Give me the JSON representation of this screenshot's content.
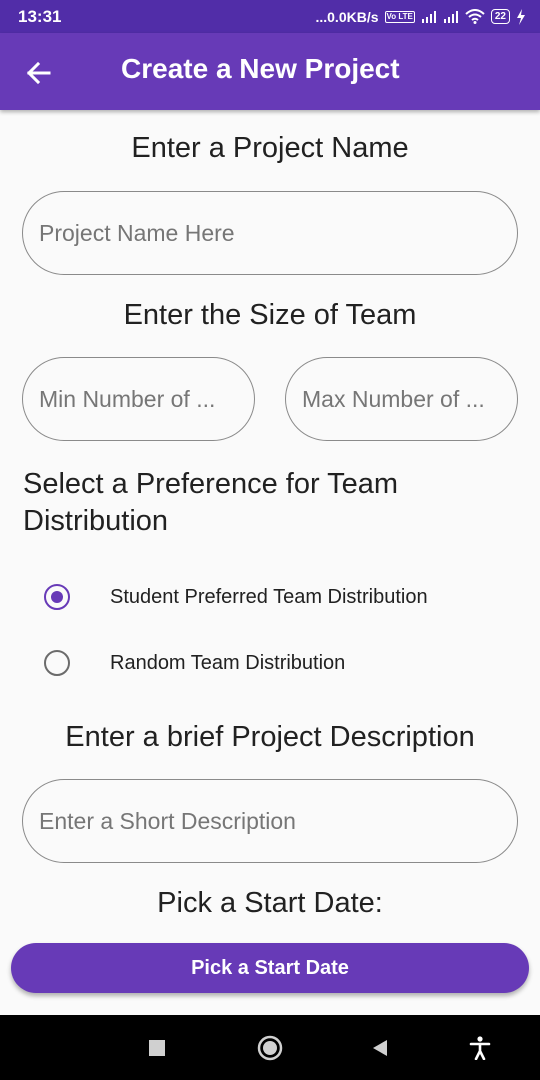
{
  "status_bar": {
    "time": "13:31",
    "network_speed": "...0.0KB/s",
    "volte": "Vo LTE",
    "battery": "22"
  },
  "app_bar": {
    "title": "Create a New Project",
    "back_icon": "arrow-back-icon",
    "background_color": "#673ab7",
    "status_color": "#512da8"
  },
  "form": {
    "project_name_heading": "Enter a Project Name",
    "project_name_placeholder": "Project Name Here",
    "team_size_heading": "Enter the Size of Team",
    "min_placeholder": "Min Number of ...",
    "max_placeholder": "Max Number of ...",
    "preference_heading": "Select a Preference for Team Distribution",
    "options": [
      {
        "label": "Student Preferred Team Distribution",
        "selected": true
      },
      {
        "label": "Random Team Distribution",
        "selected": false
      }
    ],
    "description_heading": "Enter a brief Project Description",
    "description_placeholder": "Enter a Short Description",
    "start_date_heading": "Pick a Start Date:",
    "start_date_button": "Pick a Start Date"
  },
  "nav_bar": {
    "icons": [
      "square-recents-icon",
      "circle-home-icon",
      "triangle-back-icon",
      "accessibility-icon"
    ]
  }
}
